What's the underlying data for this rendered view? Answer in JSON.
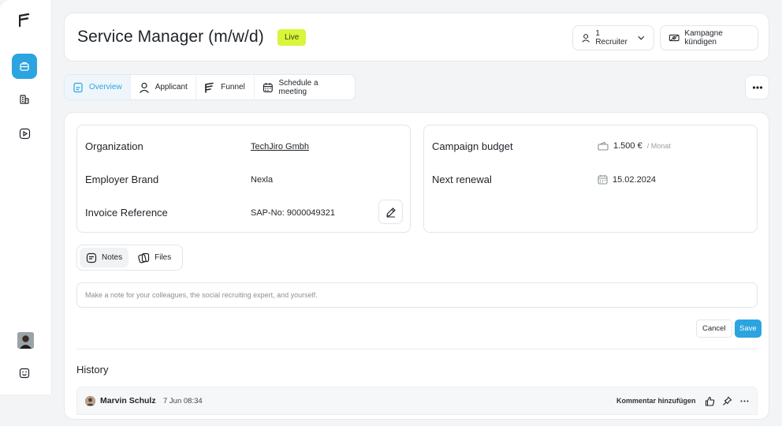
{
  "header": {
    "title": "Service Manager (m/w/d)",
    "status_badge": "Live",
    "recruiter_button": "1 Recruiter",
    "cancel_campaign_button": "Kampagne kündigen"
  },
  "tabs": [
    {
      "label": "Overview",
      "icon": "document-icon",
      "active": true
    },
    {
      "label": "Applicant",
      "icon": "user-icon",
      "active": false
    },
    {
      "label": "Funnel",
      "icon": "funnel-icon",
      "active": false
    },
    {
      "label": "Schedule a meeting",
      "icon": "calendar-icon",
      "active": false
    }
  ],
  "details": {
    "organization_label": "Organization",
    "organization_value": "TechJiro Gmbh",
    "employer_brand_label": "Employer Brand",
    "employer_brand_value": "Nexla",
    "invoice_reference_label": "Invoice Reference",
    "invoice_reference_value": "SAP-No: 9000049321",
    "campaign_budget_label": "Campaign budget",
    "campaign_budget_value": "1.500 €",
    "campaign_budget_period": "/ Monat",
    "next_renewal_label": "Next renewal",
    "next_renewal_value": "15.02.2024"
  },
  "notes": {
    "tab_notes": "Notes",
    "tab_files": "Files",
    "placeholder": "Make a note for your colleagues, the social recruiting expert, and yourself.",
    "cancel_label": "Cancel",
    "save_label": "Save"
  },
  "history": {
    "title": "History",
    "entries": [
      {
        "author": "Marvin Schulz",
        "time": "7 Jun 08:34",
        "comment_action": "Kommentar hinzufügen"
      }
    ]
  },
  "colors": {
    "accent": "#2ba4e0",
    "live_badge": "#d9f63b"
  }
}
